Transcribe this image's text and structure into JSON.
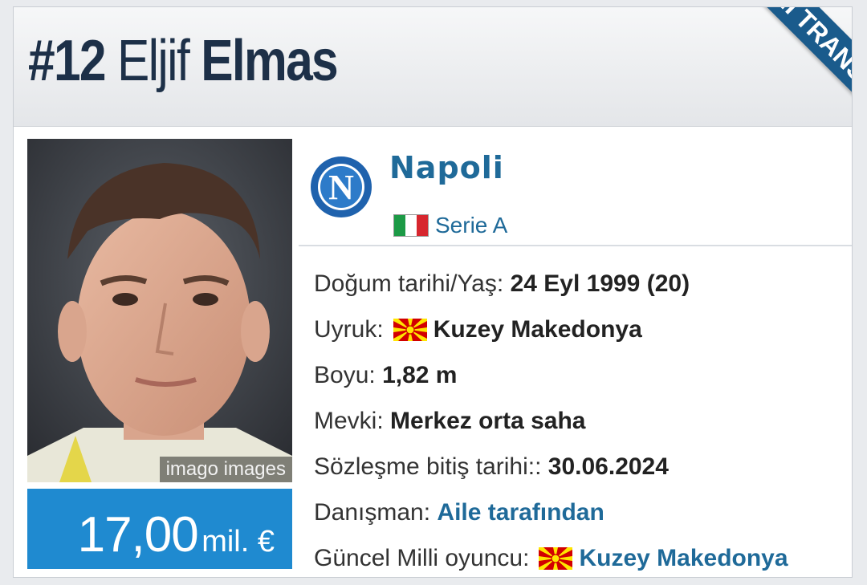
{
  "player": {
    "number": "#12",
    "first_name": "Eljif",
    "last_name": "Elmas"
  },
  "ribbon": {
    "label": "YENİ TRANSFER"
  },
  "photo": {
    "credit": "imago images"
  },
  "market_value": {
    "amount": "17,00",
    "unit": "mil. €"
  },
  "club": {
    "name": "Napoli",
    "logo_icon": "napoli-crest-icon"
  },
  "league": {
    "name": "Serie A",
    "flag_icon": "italy-flag-icon"
  },
  "details": {
    "dob": {
      "label": "Doğum tarihi/Yaş:",
      "value": "24 Eyl 1999 (20)"
    },
    "nationality": {
      "label": "Uyruk:",
      "value": "Kuzey Makedonya",
      "flag_icon": "north-macedonia-flag-icon"
    },
    "height": {
      "label": "Boyu:",
      "value": "1,82 m"
    },
    "position": {
      "label": "Mevki:",
      "value": "Merkez orta saha"
    },
    "contract": {
      "label": "Sözleşme bitiş tarihi::",
      "value": "30.06.2024"
    },
    "agent": {
      "label": "Danışman:",
      "value": "Aile tarafından"
    },
    "national_team": {
      "label": "Güncel Milli oyuncu:",
      "value": "Kuzey Makedonya",
      "flag_icon": "north-macedonia-flag-icon"
    }
  },
  "colors": {
    "title": "#1d3048",
    "accent": "#1f6a99",
    "value_box": "#1f8ad0",
    "ribbon": "#1a5b8c"
  }
}
